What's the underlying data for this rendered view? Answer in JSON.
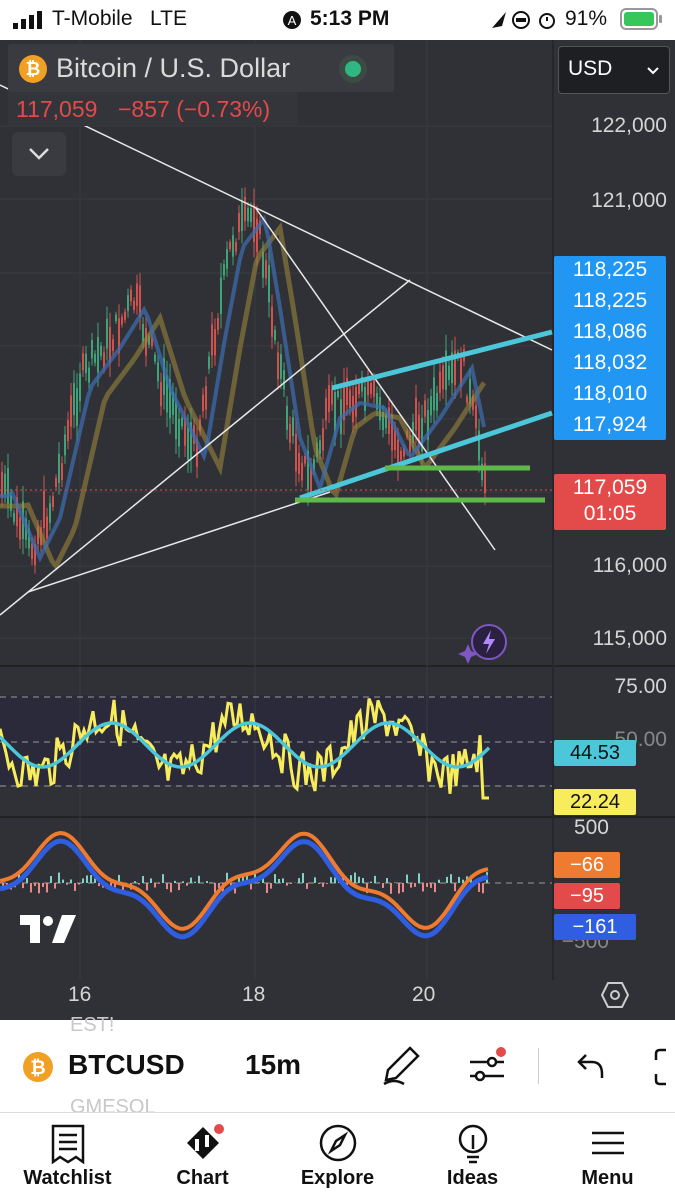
{
  "status_bar": {
    "carrier": "T-Mobile",
    "network": "LTE",
    "time": "5:13 PM",
    "battery": "91%"
  },
  "header": {
    "title": "Bitcoin / U.S. Dollar",
    "price": "117,059",
    "change": "−857 (−0.73%)",
    "currency": "USD"
  },
  "price_axis": [
    "122,000",
    "121,000",
    "116,000",
    "115,000"
  ],
  "price_tags": [
    "118,225",
    "118,225",
    "118,086",
    "118,032",
    "118,010",
    "117,924"
  ],
  "last_price": {
    "value": "117,059",
    "countdown": "01:05"
  },
  "rsi": {
    "levels": [
      "75.00",
      "50.00"
    ],
    "value_cyan": "44.53",
    "value_yellow": "22.24"
  },
  "osc": {
    "levels": [
      "500",
      "−500"
    ],
    "v1": "−66",
    "v2": "−95",
    "v3": "−161"
  },
  "time_axis": [
    "16",
    "18",
    "20"
  ],
  "symbol_bar": {
    "symbol": "BTCUSD",
    "interval": "15m",
    "ghost1": "EST!",
    "ghost2": "GMESOL"
  },
  "tabs": [
    {
      "label": "Watchlist"
    },
    {
      "label": "Chart"
    },
    {
      "label": "Explore"
    },
    {
      "label": "Ideas"
    },
    {
      "label": "Menu"
    }
  ],
  "colors": {
    "accent_blue": "#2196f3",
    "red": "#e34a4a",
    "cyan": "#4cc7d9",
    "yellow": "#f7ec5b",
    "orange": "#ee7b2f",
    "green": "#5fb84a"
  }
}
